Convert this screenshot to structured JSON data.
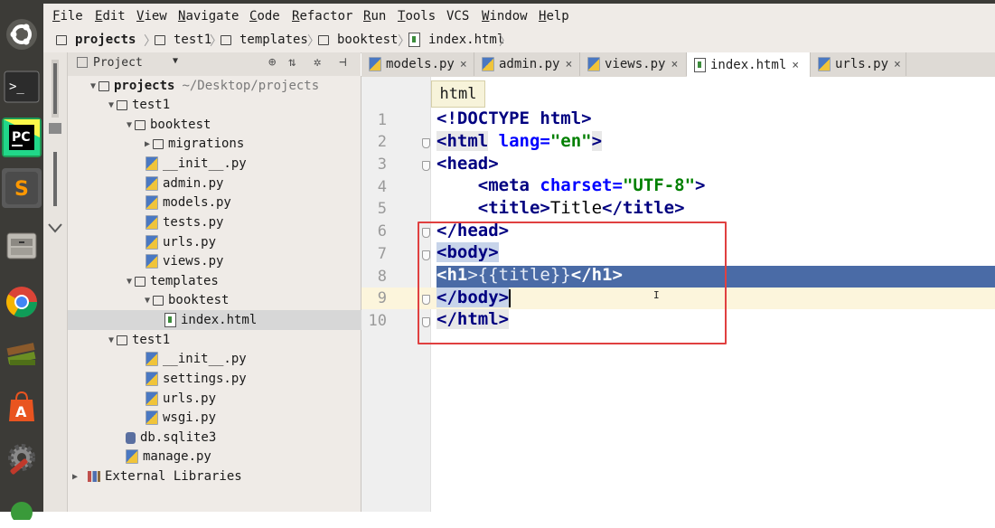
{
  "menu": [
    "File",
    "Edit",
    "View",
    "Navigate",
    "Code",
    "Refactor",
    "Run",
    "Tools",
    "VCS",
    "Window",
    "Help"
  ],
  "menu_mnemonic": [
    "F",
    "E",
    "V",
    "N",
    "C",
    "R",
    "R",
    "T",
    "",
    "W",
    "H"
  ],
  "breadcrumb": [
    "projects",
    "test1",
    "templates",
    "booktest",
    "index.html"
  ],
  "project_panel": {
    "title": "Project",
    "root_path": "~/Desktop/projects"
  },
  "tree": [
    {
      "label": "projects",
      "kind": "folder",
      "level": 0,
      "expanded": true,
      "bold": true
    },
    {
      "label": "test1",
      "kind": "folder",
      "level": 1,
      "expanded": true
    },
    {
      "label": "booktest",
      "kind": "folder",
      "level": 2,
      "expanded": true
    },
    {
      "label": "migrations",
      "kind": "folder",
      "level": 3,
      "expanded": false
    },
    {
      "label": "__init__.py",
      "kind": "py",
      "level": 3
    },
    {
      "label": "admin.py",
      "kind": "py",
      "level": 3
    },
    {
      "label": "models.py",
      "kind": "py",
      "level": 3
    },
    {
      "label": "tests.py",
      "kind": "py",
      "level": 3
    },
    {
      "label": "urls.py",
      "kind": "py",
      "level": 3
    },
    {
      "label": "views.py",
      "kind": "py",
      "level": 3
    },
    {
      "label": "templates",
      "kind": "folder",
      "level": 2,
      "expanded": true
    },
    {
      "label": "booktest",
      "kind": "folder",
      "level": 3,
      "expanded": true
    },
    {
      "label": "index.html",
      "kind": "html",
      "level": 4,
      "selected": true
    },
    {
      "label": "test1",
      "kind": "folder",
      "level": 2,
      "expanded": true
    },
    {
      "label": "__init__.py",
      "kind": "py",
      "level": 3
    },
    {
      "label": "settings.py",
      "kind": "py",
      "level": 3
    },
    {
      "label": "urls.py",
      "kind": "py",
      "level": 3
    },
    {
      "label": "wsgi.py",
      "kind": "py",
      "level": 3
    },
    {
      "label": "db.sqlite3",
      "kind": "db",
      "level": 2
    },
    {
      "label": "manage.py",
      "kind": "py",
      "level": 2
    },
    {
      "label": "External Libraries",
      "kind": "lib",
      "level": 0,
      "expanded": false
    }
  ],
  "tabs": [
    {
      "label": "models.py",
      "kind": "py"
    },
    {
      "label": "admin.py",
      "kind": "py"
    },
    {
      "label": "views.py",
      "kind": "py"
    },
    {
      "label": "index.html",
      "kind": "html",
      "active": true
    },
    {
      "label": "urls.py",
      "kind": "py"
    }
  ],
  "editor": {
    "breadcrumb_tip": "html",
    "line_numbers": [
      "1",
      "2",
      "3",
      "4",
      "5",
      "6",
      "7",
      "8",
      "9",
      "10"
    ],
    "tokens": {
      "doctype": "<!DOCTYPE",
      "html_kw": "html",
      "gt": ">",
      "html_open": "<html",
      "lang_attr": "lang=",
      "lang_val": "\"en\"",
      "head_open": "<head>",
      "meta_open": "<meta",
      "charset_attr": "charset=",
      "charset_val": "\"UTF-8\"",
      "title_open": "<title>",
      "title_text": "Title",
      "title_close": "</title>",
      "head_close": "</head>",
      "body_open": "<body>",
      "h1_open": "<h1",
      "h1_expr": "{{title}}",
      "h1_close": "</h1>",
      "body_close": "</body>",
      "html_close": "</html>"
    }
  },
  "colors": {
    "selection": "#4a6ba6",
    "caret_line": "#fcf5dc",
    "annotation_box": "#e04040",
    "launcher": "#3c3b37"
  },
  "launcher_icons": [
    "ubuntu-logo-icon",
    "terminal-icon",
    "pycharm-icon",
    "sublime-text-icon",
    "file-manager-icon",
    "chrome-icon",
    "books-icon",
    "software-center-icon",
    "system-settings-icon",
    "more-icon"
  ],
  "launcher_labels": {
    "pycharm": "PC",
    "sublime": "S",
    "software": "A"
  }
}
